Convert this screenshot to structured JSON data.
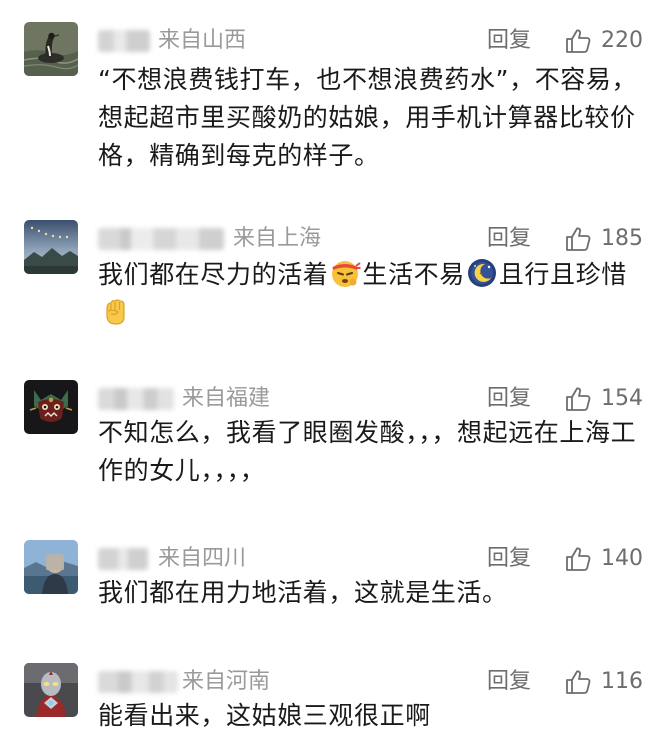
{
  "comments": [
    {
      "location": "来自山西",
      "reply_label": "回复",
      "likes": "220",
      "text": "“不想浪费钱打车，也不想浪费药水”，不容易，想起超市里买酸奶的姑娘，用手机计算器比较价格，精确到每克的样子。"
    },
    {
      "location": "来自上海",
      "reply_label": "回复",
      "likes": "185",
      "text_parts": [
        "我们都在尽力的活着",
        "生活不易",
        "且行且珍惜"
      ],
      "emojis": [
        "determined-face-emoji",
        "moon-night-emoji",
        "fist-emoji"
      ]
    },
    {
      "location": "来自福建",
      "reply_label": "回复",
      "likes": "154",
      "text": "不知怎么，我看了眼圈发酸，，，想起远在上海工作的女儿，，，，"
    },
    {
      "location": "来自四川",
      "reply_label": "回复",
      "likes": "140",
      "text": "我们都在用力地活着，这就是生活。"
    },
    {
      "location": "来自河南",
      "reply_label": "回复",
      "likes": "116",
      "text": "能看出来，这姑娘三观很正啊"
    }
  ],
  "colors": {
    "meta_text": "#9a9a9a",
    "action_text": "#6d6d6d",
    "body_text": "#1a1a1a"
  }
}
